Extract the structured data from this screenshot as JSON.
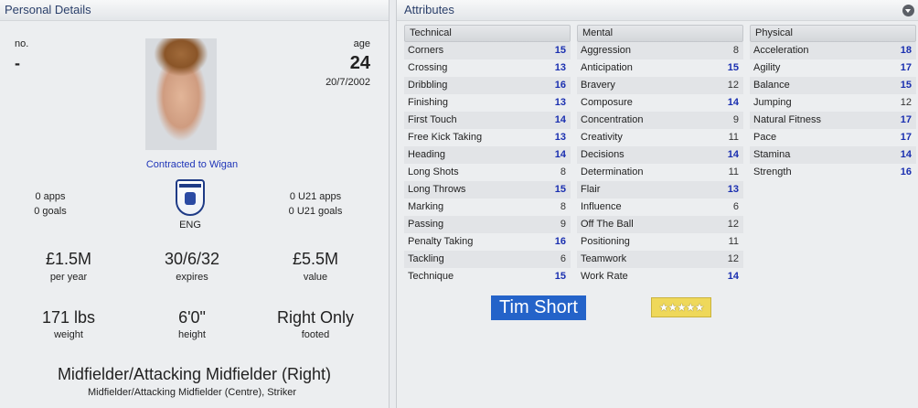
{
  "personal": {
    "header": "Personal Details",
    "no_label": "no.",
    "no_value": "-",
    "age_label": "age",
    "age_value": "24",
    "dob": "20/7/2002",
    "contract": "Contracted to Wigan",
    "apps": "0 apps",
    "goals": "0 goals",
    "nation": "ENG",
    "u21_apps": "0 U21 apps",
    "u21_goals": "0 U21 goals",
    "wage_value": "£1.5M",
    "wage_label": "per year",
    "expires_value": "30/6/32",
    "expires_label": "expires",
    "value_value": "£5.5M",
    "value_label": "value",
    "weight_value": "171 lbs",
    "weight_label": "weight",
    "height_value": "6'0\"",
    "height_label": "height",
    "foot_value": "Right Only",
    "foot_label": "footed",
    "position_main": "Midfielder/Attacking Midfielder (Right)",
    "position_other": "Midfielder/Attacking Midfielder (Centre), Striker"
  },
  "attributes": {
    "header": "Attributes",
    "technical": {
      "title": "Technical",
      "items": [
        {
          "name": "Corners",
          "value": "15"
        },
        {
          "name": "Crossing",
          "value": "13"
        },
        {
          "name": "Dribbling",
          "value": "16"
        },
        {
          "name": "Finishing",
          "value": "13"
        },
        {
          "name": "First Touch",
          "value": "14"
        },
        {
          "name": "Free Kick Taking",
          "value": "13"
        },
        {
          "name": "Heading",
          "value": "14"
        },
        {
          "name": "Long Shots",
          "value": "8"
        },
        {
          "name": "Long Throws",
          "value": "15"
        },
        {
          "name": "Marking",
          "value": "8"
        },
        {
          "name": "Passing",
          "value": "9"
        },
        {
          "name": "Penalty Taking",
          "value": "16"
        },
        {
          "name": "Tackling",
          "value": "6"
        },
        {
          "name": "Technique",
          "value": "15"
        }
      ]
    },
    "mental": {
      "title": "Mental",
      "items": [
        {
          "name": "Aggression",
          "value": "8"
        },
        {
          "name": "Anticipation",
          "value": "15"
        },
        {
          "name": "Bravery",
          "value": "12"
        },
        {
          "name": "Composure",
          "value": "14"
        },
        {
          "name": "Concentration",
          "value": "9"
        },
        {
          "name": "Creativity",
          "value": "11"
        },
        {
          "name": "Decisions",
          "value": "14"
        },
        {
          "name": "Determination",
          "value": "11"
        },
        {
          "name": "Flair",
          "value": "13"
        },
        {
          "name": "Influence",
          "value": "6"
        },
        {
          "name": "Off The Ball",
          "value": "12"
        },
        {
          "name": "Positioning",
          "value": "11"
        },
        {
          "name": "Teamwork",
          "value": "12"
        },
        {
          "name": "Work Rate",
          "value": "14"
        }
      ]
    },
    "physical": {
      "title": "Physical",
      "items": [
        {
          "name": "Acceleration",
          "value": "18"
        },
        {
          "name": "Agility",
          "value": "17"
        },
        {
          "name": "Balance",
          "value": "15"
        },
        {
          "name": "Jumping",
          "value": "12"
        },
        {
          "name": "Natural Fitness",
          "value": "17"
        },
        {
          "name": "Pace",
          "value": "17"
        },
        {
          "name": "Stamina",
          "value": "14"
        },
        {
          "name": "Strength",
          "value": "16"
        }
      ]
    }
  },
  "player_name": "Tim Short",
  "star_rating": 5,
  "stars_glyph": "★★★★★",
  "colors": {
    "high_value": "#1a2fb0",
    "name_badge": "#2463c9",
    "stars_bg": "#efd85a"
  },
  "icons": {
    "collapse": "chevron-down-icon",
    "crest": "england-crest-icon"
  }
}
